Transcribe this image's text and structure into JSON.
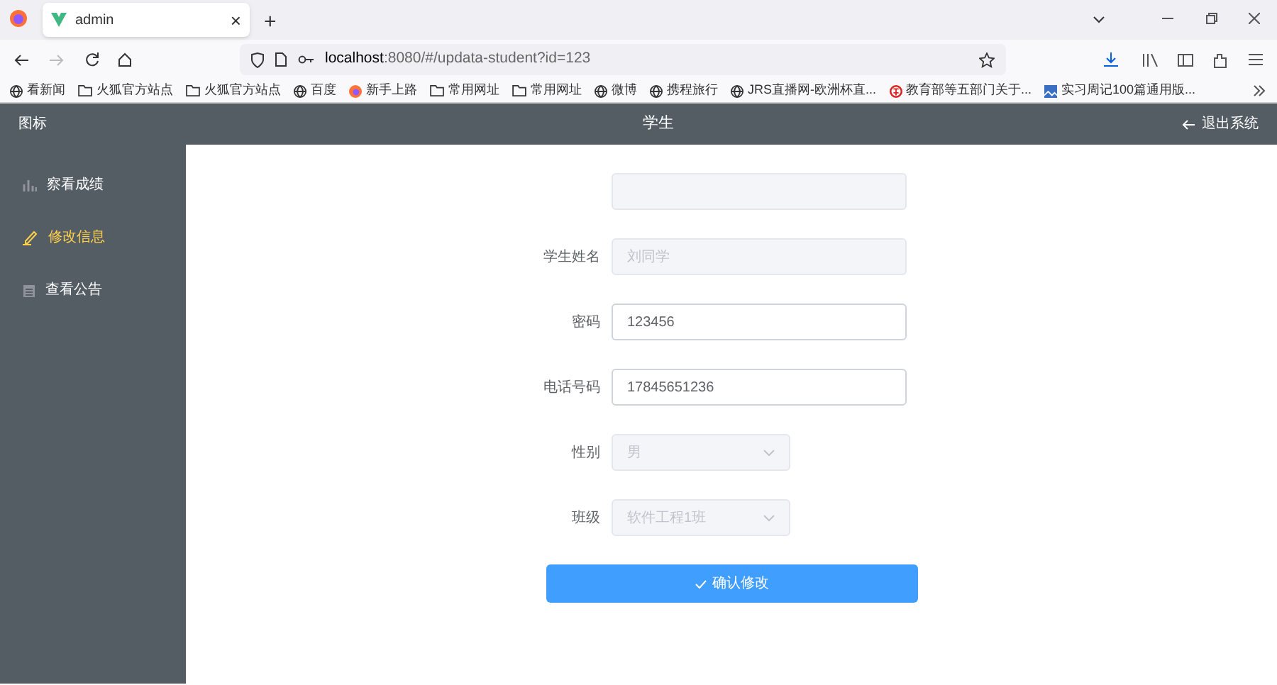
{
  "browser": {
    "tab": {
      "title": "admin",
      "close": "×"
    },
    "new_tab": "+",
    "url": {
      "host": "localhost",
      "rest": ":8080/#/updata-student?id=123"
    },
    "bookmarks": [
      {
        "kind": "globe",
        "label": "看新闻"
      },
      {
        "kind": "folder",
        "label": "火狐官方站点"
      },
      {
        "kind": "folder",
        "label": "火狐官方站点"
      },
      {
        "kind": "globe",
        "label": "百度"
      },
      {
        "kind": "fox",
        "label": "新手上路"
      },
      {
        "kind": "folder",
        "label": "常用网址"
      },
      {
        "kind": "folder",
        "label": "常用网址"
      },
      {
        "kind": "globe",
        "label": "微博"
      },
      {
        "kind": "globe",
        "label": "携程旅行"
      },
      {
        "kind": "globe",
        "label": "JRS直播网-欧洲杯直..."
      },
      {
        "kind": "seal",
        "label": "教育部等五部门关于..."
      },
      {
        "kind": "image",
        "label": "实习周记100篇通用版..."
      }
    ]
  },
  "app": {
    "logo": "图标",
    "title": "学生",
    "logout": "退出系统",
    "sidebar": {
      "items": [
        {
          "kind": "chart",
          "label": "察看成绩",
          "selected": false
        },
        {
          "kind": "edit",
          "label": "修改信息",
          "selected": true
        },
        {
          "kind": "doc",
          "label": "查看公告",
          "selected": false
        }
      ]
    },
    "form": {
      "fields": [
        {
          "kind": "input",
          "disabled": true
        },
        {
          "kind": "input",
          "label": "学生姓名",
          "value": "刘同学",
          "disabled": true
        },
        {
          "kind": "input",
          "label": "密码",
          "value": "123456",
          "disabled": false
        },
        {
          "kind": "input",
          "label": "电话号码",
          "value": "17845651236",
          "disabled": false
        },
        {
          "kind": "select",
          "label": "性别",
          "value": "男",
          "disabled": true
        },
        {
          "kind": "select",
          "label": "班级",
          "value": "软件工程1班",
          "disabled": true
        }
      ],
      "submit": "确认修改"
    }
  }
}
